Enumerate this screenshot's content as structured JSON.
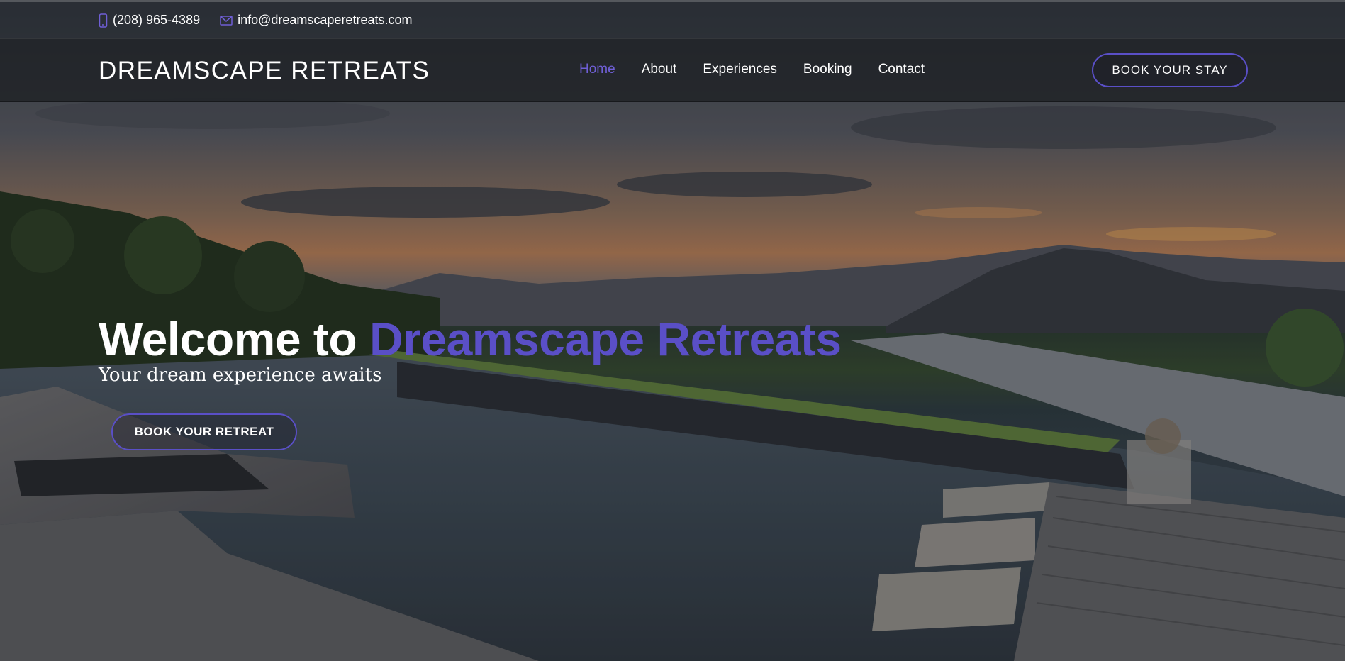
{
  "topbar": {
    "phone": "(208) 965-4389",
    "phone_icon": "phone-icon",
    "email": "info@dreamscaperetreats.com",
    "email_icon": "mail-icon"
  },
  "navbar": {
    "brand": "DREAMSCAPE RETREATS",
    "links": [
      "Home",
      "About",
      "Experiences",
      "Booking",
      "Contact"
    ],
    "active_link": "Home",
    "cta_label": "BOOK YOUR STAY"
  },
  "hero": {
    "headline_prefix": "Welcome to",
    "headline_accent": "Dreamscape Retreats",
    "subtitle": "Your dream experience awaits",
    "cta_label": "BOOK YOUR RETREAT"
  },
  "colors": {
    "accent": "#5a4fc7",
    "active_nav": "#6f5fd6",
    "text": "#ffffff"
  }
}
